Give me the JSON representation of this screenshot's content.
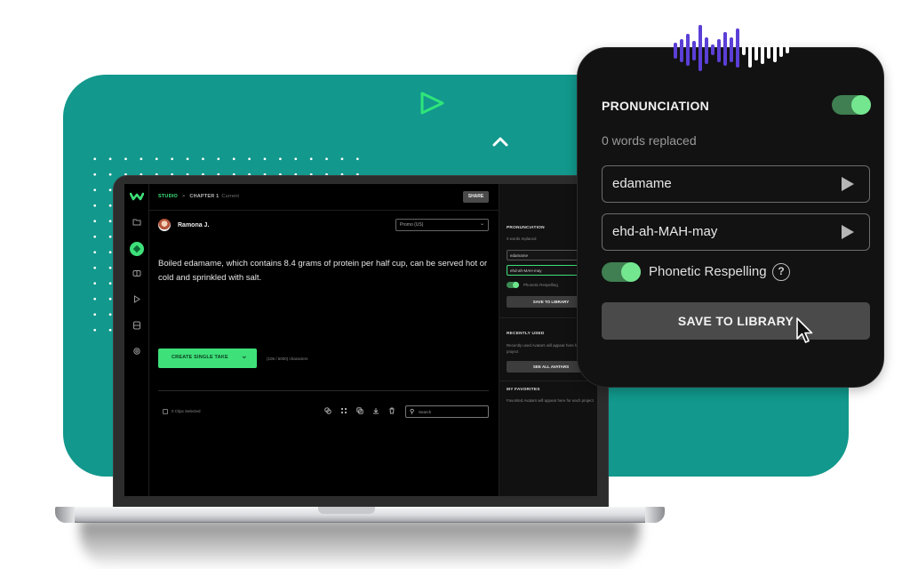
{
  "colors": {
    "teal_background": "#12988c",
    "accent_green": "#3ee07a",
    "wave_purple": "#5b3fd6",
    "card_background": "#121212"
  },
  "decorations": {
    "play_icon": "play-outline-icon",
    "chevron_icon": "chevron-up-icon",
    "waveform_icon": "audio-waveform-icon"
  },
  "app": {
    "breadcrumb": {
      "root": "STUDIO",
      "separator": ">",
      "chapter": "CHAPTER 1",
      "status": "Current"
    },
    "share_label": "SHARE",
    "sidebar": {
      "items": [
        {
          "name": "folder",
          "icon": "folder-icon"
        },
        {
          "name": "voice",
          "icon": "voice-icon",
          "active": true
        },
        {
          "name": "library",
          "icon": "book-icon"
        },
        {
          "name": "play",
          "icon": "play-icon"
        },
        {
          "name": "storage",
          "icon": "database-icon"
        },
        {
          "name": "settings",
          "icon": "gear-icon"
        }
      ]
    },
    "voice": {
      "name": "Ramona J.",
      "style_select": "Promo (US)"
    },
    "script_text": "Boiled edamame, which contains 8.4 grams of protein per half cup, can be served hot or cold and sprinkled with salt.",
    "create_button": "CREATE SINGLE TAKE",
    "char_count": "(106 / 5000) characters",
    "clips_selected": "0 Clips Selected",
    "toolbar_icons": [
      "merge-icon",
      "grid-icon",
      "duplicate-icon",
      "download-icon",
      "trash-icon"
    ],
    "search_placeholder": "Search",
    "right_panel": {
      "pronunciation_title": "PRONUNCIATION",
      "words_replaced": "0 words replaced",
      "word_value": "edamame",
      "respelling_value": "ehd-ah-MAH-may",
      "phonetic_label": "Phonetic Respelling",
      "save_label": "SAVE TO LIBRARY",
      "recent_title": "RECENTLY USED",
      "recent_text": "Recently used Avatars will appear here for each project",
      "see_all_label": "SEE ALL AVATARS",
      "favorites_title": "MY FAVORITES",
      "favorites_text": "Favorited Avatars will appear here for each project"
    }
  },
  "card": {
    "title": "PRONUNCIATION",
    "toggle_on": true,
    "words_replaced": "0 words replaced",
    "word_field": "edamame",
    "respelling_field": "ehd-ah-MAH-may",
    "phonetic_label": "Phonetic Respelling",
    "phonetic_on": true,
    "help_glyph": "?",
    "save_label": "SAVE TO LIBRARY"
  }
}
